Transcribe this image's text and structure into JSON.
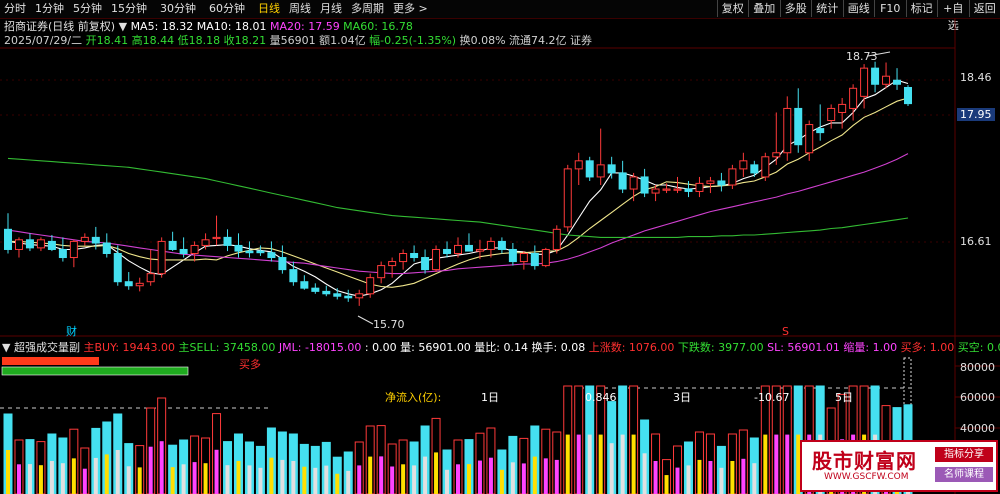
{
  "toolbar": {
    "tabs": [
      "分时",
      "1分钟",
      "5分钟",
      "15分钟",
      "30分钟",
      "60分钟",
      "日线",
      "周线",
      "月线",
      "多周期",
      "更多"
    ],
    "active": "日线",
    "right_buttons": [
      "复权",
      "叠加",
      "多股",
      "统计",
      "画线",
      "F10",
      "标记",
      "+自选",
      "返回"
    ]
  },
  "stock": {
    "title": "招商证券(日线 前复权)",
    "ma": [
      {
        "label": "MA5: 18.32",
        "color": "#ffffff"
      },
      {
        "label": "MA10: 18.01",
        "color": "#ffffff"
      },
      {
        "label": "MA20: 17.59",
        "color": "#ff44ff"
      },
      {
        "label": "MA60: 16.78",
        "color": "#33dd33"
      }
    ],
    "info": [
      {
        "text": "2025/07/29/二",
        "color": "#d0d0d0"
      },
      {
        "text": "开18.41",
        "color": "#33dd33"
      },
      {
        "text": "高18.44",
        "color": "#33dd33"
      },
      {
        "text": "低18.18",
        "color": "#33dd33"
      },
      {
        "text": "收18.21",
        "color": "#33dd33"
      },
      {
        "text": "量56901",
        "color": "#d0d0d0"
      },
      {
        "text": "额1.04亿",
        "color": "#d0d0d0"
      },
      {
        "text": "幅-0.25(-1.35%)",
        "color": "#33dd33"
      },
      {
        "text": "换0.08%",
        "color": "#d0d0d0"
      },
      {
        "text": "流通74.2亿",
        "color": "#d0d0d0"
      },
      {
        "text": "证券",
        "color": "#d0d0d0"
      }
    ],
    "price_labels": {
      "right_top": "18.46",
      "current": "17.95",
      "right_bottom": "16.61",
      "high_mark": "18.73",
      "low_mark": "15.70"
    },
    "marker_cai": "财",
    "marker_s": "S"
  },
  "chart_data": {
    "type": "candlestick",
    "ylim": [
      15.5,
      18.9
    ],
    "ohlc": [
      [
        16.65,
        16.85,
        16.35,
        16.4
      ],
      [
        16.4,
        16.55,
        16.3,
        16.52
      ],
      [
        16.52,
        16.6,
        16.38,
        16.42
      ],
      [
        16.42,
        16.55,
        16.38,
        16.52
      ],
      [
        16.5,
        16.58,
        16.38,
        16.4
      ],
      [
        16.4,
        16.55,
        16.25,
        16.3
      ],
      [
        16.3,
        16.52,
        16.18,
        16.5
      ],
      [
        16.5,
        16.6,
        16.45,
        16.55
      ],
      [
        16.55,
        16.68,
        16.4,
        16.48
      ],
      [
        16.48,
        16.6,
        16.3,
        16.35
      ],
      [
        16.35,
        16.45,
        15.95,
        16.0
      ],
      [
        16.0,
        16.12,
        15.9,
        15.95
      ],
      [
        15.95,
        16.05,
        15.88,
        15.98
      ],
      [
        16.0,
        16.4,
        15.95,
        16.1
      ],
      [
        16.1,
        16.55,
        16.05,
        16.5
      ],
      [
        16.5,
        16.62,
        16.38,
        16.4
      ],
      [
        16.4,
        16.55,
        16.3,
        16.35
      ],
      [
        16.35,
        16.5,
        16.25,
        16.45
      ],
      [
        16.45,
        16.6,
        16.4,
        16.52
      ],
      [
        16.55,
        16.82,
        16.45,
        16.55
      ],
      [
        16.55,
        16.65,
        16.38,
        16.45
      ],
      [
        16.45,
        16.6,
        16.3,
        16.38
      ],
      [
        16.38,
        16.5,
        16.3,
        16.36
      ],
      [
        16.38,
        16.45,
        16.32,
        16.36
      ],
      [
        16.36,
        16.5,
        16.25,
        16.3
      ],
      [
        16.3,
        16.45,
        16.1,
        16.15
      ],
      [
        16.15,
        16.25,
        15.95,
        16.0
      ],
      [
        16.0,
        16.08,
        15.9,
        15.92
      ],
      [
        15.92,
        15.98,
        15.85,
        15.88
      ],
      [
        15.88,
        15.95,
        15.82,
        15.85
      ],
      [
        15.85,
        15.92,
        15.78,
        15.82
      ],
      [
        15.82,
        15.9,
        15.75,
        15.8
      ],
      [
        15.8,
        15.9,
        15.7,
        15.85
      ],
      [
        15.85,
        16.1,
        15.8,
        16.05
      ],
      [
        16.05,
        16.25,
        15.98,
        16.2
      ],
      [
        16.2,
        16.3,
        16.05,
        16.25
      ],
      [
        16.25,
        16.4,
        16.15,
        16.35
      ],
      [
        16.35,
        16.45,
        16.25,
        16.3
      ],
      [
        16.3,
        16.4,
        16.1,
        16.15
      ],
      [
        16.15,
        16.45,
        16.12,
        16.4
      ],
      [
        16.4,
        16.5,
        16.3,
        16.35
      ],
      [
        16.35,
        16.55,
        16.3,
        16.45
      ],
      [
        16.45,
        16.6,
        16.38,
        16.38
      ],
      [
        16.38,
        16.52,
        16.28,
        16.4
      ],
      [
        16.4,
        16.55,
        16.3,
        16.5
      ],
      [
        16.5,
        16.55,
        16.35,
        16.4
      ],
      [
        16.4,
        16.48,
        16.2,
        16.25
      ],
      [
        16.25,
        16.38,
        16.15,
        16.35
      ],
      [
        16.35,
        16.45,
        16.15,
        16.2
      ],
      [
        16.2,
        16.42,
        16.18,
        16.4
      ],
      [
        16.4,
        16.7,
        16.35,
        16.65
      ],
      [
        16.68,
        17.45,
        16.62,
        17.4
      ],
      [
        17.4,
        17.6,
        17.2,
        17.5
      ],
      [
        17.5,
        17.55,
        17.25,
        17.3
      ],
      [
        17.3,
        17.9,
        17.2,
        17.45
      ],
      [
        17.45,
        17.55,
        17.28,
        17.35
      ],
      [
        17.35,
        17.5,
        17.1,
        17.15
      ],
      [
        17.15,
        17.35,
        17.0,
        17.3
      ],
      [
        17.3,
        17.4,
        17.05,
        17.1
      ],
      [
        17.1,
        17.2,
        17.0,
        17.15
      ],
      [
        17.15,
        17.22,
        17.1,
        17.15
      ],
      [
        17.15,
        17.3,
        17.1,
        17.15
      ],
      [
        17.15,
        17.25,
        17.05,
        17.12
      ],
      [
        17.12,
        17.3,
        17.05,
        17.22
      ],
      [
        17.22,
        17.3,
        17.1,
        17.25
      ],
      [
        17.25,
        17.35,
        17.12,
        17.2
      ],
      [
        17.2,
        17.45,
        17.15,
        17.4
      ],
      [
        17.4,
        17.6,
        17.3,
        17.5
      ],
      [
        17.45,
        17.5,
        17.3,
        17.35
      ],
      [
        17.3,
        17.6,
        17.25,
        17.55
      ],
      [
        17.55,
        18.1,
        17.45,
        17.6
      ],
      [
        17.6,
        18.3,
        17.5,
        18.15
      ],
      [
        18.15,
        18.4,
        17.6,
        17.7
      ],
      [
        17.6,
        18.0,
        17.5,
        17.95
      ],
      [
        17.9,
        18.2,
        17.75,
        17.85
      ],
      [
        18.0,
        18.2,
        17.9,
        18.15
      ],
      [
        18.1,
        18.28,
        17.9,
        18.2
      ],
      [
        18.15,
        18.45,
        18.0,
        18.4
      ],
      [
        18.3,
        18.7,
        18.15,
        18.65
      ],
      [
        18.65,
        18.73,
        18.35,
        18.45
      ],
      [
        18.45,
        18.72,
        18.4,
        18.55
      ],
      [
        18.5,
        18.65,
        18.38,
        18.45
      ],
      [
        18.41,
        18.44,
        18.18,
        18.21
      ]
    ],
    "ma_series": [
      {
        "name": "MA5",
        "color": "#ffffff",
        "values": [
          16.5,
          16.48,
          16.46,
          16.45,
          16.44,
          16.4,
          16.4,
          16.42,
          16.45,
          16.46,
          16.36,
          16.26,
          16.18,
          16.11,
          16.09,
          16.18,
          16.27,
          16.36,
          16.44,
          16.45,
          16.46,
          16.44,
          16.41,
          16.39,
          16.37,
          16.28,
          16.19,
          16.13,
          16.06,
          15.97,
          15.89,
          15.85,
          15.82,
          15.85,
          15.9,
          15.98,
          16.1,
          16.22,
          16.26,
          16.29,
          16.31,
          16.33,
          16.35,
          16.38,
          16.42,
          16.42,
          16.38,
          16.37,
          16.34,
          16.34,
          16.39,
          16.58,
          16.79,
          17.0,
          17.14,
          17.35,
          17.35,
          17.31,
          17.26,
          17.2,
          17.2,
          17.17,
          17.15,
          17.16,
          17.18,
          17.19,
          17.22,
          17.28,
          17.32,
          17.42,
          17.52,
          17.69,
          17.76,
          17.85,
          17.92,
          17.97,
          17.97,
          18.1,
          18.27,
          18.32,
          18.41,
          18.5,
          18.46
        ]
      },
      {
        "name": "MA10",
        "color": "#f0e68c",
        "values": [
          16.5,
          16.5,
          16.49,
          16.48,
          16.47,
          16.45,
          16.44,
          16.44,
          16.44,
          16.45,
          16.41,
          16.35,
          16.31,
          16.28,
          16.27,
          16.27,
          16.27,
          16.27,
          16.28,
          16.27,
          16.32,
          16.36,
          16.39,
          16.42,
          16.41,
          16.37,
          16.32,
          16.27,
          16.22,
          16.17,
          16.12,
          16.07,
          16.02,
          15.97,
          15.94,
          15.93,
          15.95,
          15.98,
          16.04,
          16.1,
          16.16,
          16.22,
          16.27,
          16.31,
          16.33,
          16.35,
          16.36,
          16.36,
          16.37,
          16.38,
          16.38,
          16.45,
          16.55,
          16.66,
          16.76,
          16.86,
          16.96,
          17.06,
          17.14,
          17.18,
          17.24,
          17.23,
          17.21,
          17.19,
          17.18,
          17.19,
          17.2,
          17.23,
          17.25,
          17.3,
          17.36,
          17.46,
          17.52,
          17.6,
          17.67,
          17.75,
          17.82,
          17.94,
          18.04,
          18.1,
          18.17,
          18.24,
          18.28
        ]
      },
      {
        "name": "MA20",
        "color": "#d040d0",
        "values": [
          16.64,
          16.62,
          16.6,
          16.58,
          16.56,
          16.54,
          16.52,
          16.5,
          16.49,
          16.48,
          16.46,
          16.44,
          16.42,
          16.4,
          16.38,
          16.36,
          16.34,
          16.33,
          16.32,
          16.31,
          16.3,
          16.29,
          16.28,
          16.27,
          16.26,
          16.25,
          16.24,
          16.23,
          16.21,
          16.19,
          16.17,
          16.15,
          16.13,
          16.12,
          16.11,
          16.1,
          16.1,
          16.11,
          16.12,
          16.13,
          16.14,
          16.16,
          16.17,
          16.18,
          16.19,
          16.2,
          16.21,
          16.22,
          16.22,
          16.23,
          16.25,
          16.28,
          16.32,
          16.37,
          16.42,
          16.48,
          16.53,
          16.58,
          16.63,
          16.67,
          16.71,
          16.75,
          16.79,
          16.83,
          16.87,
          16.9,
          16.93,
          16.96,
          16.99,
          17.02,
          17.05,
          17.09,
          17.12,
          17.16,
          17.2,
          17.24,
          17.28,
          17.32,
          17.36,
          17.41,
          17.46,
          17.52,
          17.59
        ]
      },
      {
        "name": "MA60",
        "color": "#33bb33",
        "values": [
          17.53,
          17.52,
          17.51,
          17.5,
          17.49,
          17.48,
          17.47,
          17.46,
          17.45,
          17.44,
          17.43,
          17.42,
          17.4,
          17.38,
          17.36,
          17.34,
          17.32,
          17.3,
          17.28,
          17.25,
          17.22,
          17.19,
          17.16,
          17.13,
          17.1,
          17.07,
          17.04,
          17.01,
          16.98,
          16.95,
          16.92,
          16.9,
          16.88,
          16.86,
          16.84,
          16.82,
          16.81,
          16.8,
          16.79,
          16.78,
          16.77,
          16.76,
          16.75,
          16.74,
          16.72,
          16.7,
          16.68,
          16.66,
          16.64,
          16.62,
          16.6,
          16.58,
          16.57,
          16.56,
          16.55,
          16.55,
          16.55,
          16.55,
          16.55,
          16.55,
          16.55,
          16.55,
          16.56,
          16.56,
          16.56,
          16.57,
          16.57,
          16.58,
          16.58,
          16.59,
          16.6,
          16.61,
          16.62,
          16.63,
          16.64,
          16.66,
          16.67,
          16.69,
          16.71,
          16.73,
          16.75,
          16.77,
          16.79
        ]
      }
    ]
  },
  "indicator": {
    "name": "超强成交量副",
    "items": [
      {
        "text": "主BUY: 19443.00",
        "color": "#ff3030"
      },
      {
        "text": "主SELL: 37458.00",
        "color": "#33dd33"
      },
      {
        "text": "JML: -18015.00",
        "color": "#ff44ff"
      },
      {
        "text": ": 0.00",
        "color": "#ffffff"
      },
      {
        "text": "量: 56901.00",
        "color": "#ffffff"
      },
      {
        "text": "量比: 0.14",
        "color": "#ffffff"
      },
      {
        "text": "换手: 0.08",
        "color": "#ffffff"
      },
      {
        "text": "上涨数: 1076.00",
        "color": "#ff3030"
      },
      {
        "text": "下跌数: 3977.00",
        "color": "#33dd33"
      },
      {
        "text": "SL: 56901.01",
        "color": "#ff44ff"
      },
      {
        "text": "缩量: 1.00",
        "color": "#ff44ff"
      },
      {
        "text": "买多: 1.00",
        "color": "#ff3030"
      },
      {
        "text": "买空: 0.00",
        "color": "#33dd33"
      }
    ],
    "buy_more": "买多",
    "net_inflow_label": "净流入(亿):",
    "day1": "1日",
    "day3": "3日",
    "day5": "5日",
    "val1": "0.846",
    "val2": "-10.67",
    "axis": [
      "80000",
      "60000",
      "40000"
    ]
  },
  "watermark": {
    "brand": "股市财富网",
    "url": "WWW.GSCFW.COM",
    "tag1": "指标分享",
    "tag2": "名师课程"
  }
}
